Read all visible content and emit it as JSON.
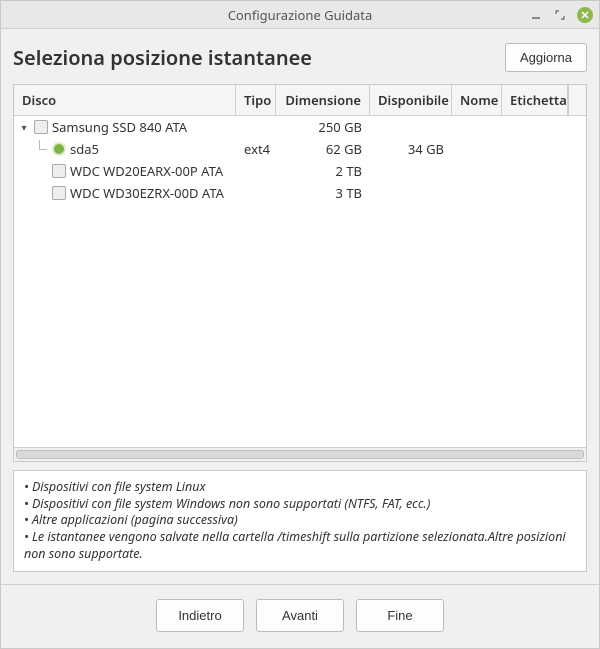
{
  "window": {
    "title": "Configurazione Guidata"
  },
  "header": {
    "title": "Seleziona posizione istantanee",
    "refresh_label": "Aggiorna"
  },
  "columns": {
    "disco": "Disco",
    "tipo": "Tipo",
    "dimensione": "Dimensione",
    "disponibile": "Disponibile",
    "nome": "Nome",
    "etichetta": "Etichetta"
  },
  "rows": [
    {
      "indent": 0,
      "expander": "▾",
      "icon": "disk",
      "disco": "Samsung SSD 840 ATA",
      "tipo": "",
      "dim": "250 GB",
      "disp": "",
      "nome": "",
      "etic": ""
    },
    {
      "indent": 1,
      "expander": "",
      "icon": "part",
      "elbow": true,
      "disco": "sda5",
      "tipo": "ext4",
      "dim": "62 GB",
      "disp": "34 GB",
      "nome": "",
      "etic": ""
    },
    {
      "indent": 1,
      "expander": "",
      "icon": "disk",
      "disco": "WDC WD20EARX-00P ATA",
      "tipo": "",
      "dim": "2 TB",
      "disp": "",
      "nome": "",
      "etic": ""
    },
    {
      "indent": 1,
      "expander": "",
      "icon": "disk",
      "disco": "WDC WD30EZRX-00D ATA",
      "tipo": "",
      "dim": "3 TB",
      "disp": "",
      "nome": "",
      "etic": ""
    }
  ],
  "info": {
    "l1": "• Dispositivi con file system Linux",
    "l2": "• Dispositivi con file system Windows non sono supportati (NTFS, FAT, ecc.)",
    "l3": "• Altre applicazioni (pagina successiva)",
    "l4": "• Le istantanee vengono salvate nella cartella /timeshift sulla partizione selezionata.Altre posizioni non sono supportate."
  },
  "footer": {
    "back": "Indietro",
    "next": "Avanti",
    "finish": "Fine"
  }
}
